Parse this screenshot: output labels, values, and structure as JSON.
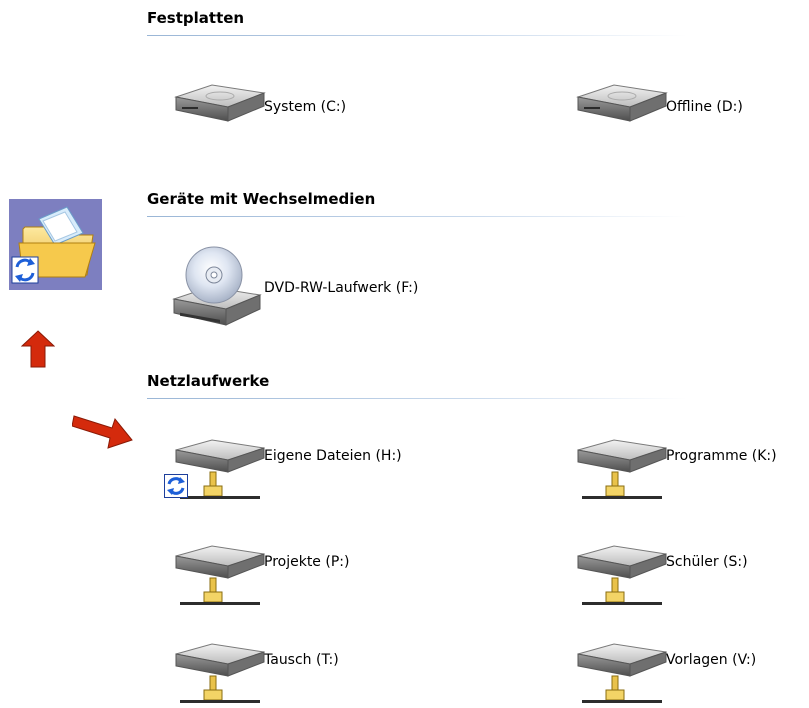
{
  "groups": [
    {
      "title": "Festplatten",
      "drives": [
        {
          "label": "System (C:)",
          "icon": "hard-disk-icon"
        },
        {
          "label": "Offline (D:)",
          "icon": "hard-disk-icon"
        }
      ]
    },
    {
      "title": "Geräte mit Wechselmedien",
      "drives": [
        {
          "label": "DVD-RW-Laufwerk (F:)",
          "icon": "dvd-drive-icon"
        }
      ]
    },
    {
      "title": "Netzlaufwerke",
      "drives": [
        {
          "label": "Eigene Dateien (H:)",
          "icon": "network-drive-icon",
          "badge": "sync-icon"
        },
        {
          "label": "Programme (K:)",
          "icon": "network-drive-icon"
        },
        {
          "label": "Projekte (P:)",
          "icon": "network-drive-icon"
        },
        {
          "label": "Schüler (S:)",
          "icon": "network-drive-icon"
        },
        {
          "label": "Tausch (T:)",
          "icon": "network-drive-icon"
        },
        {
          "label": "Vorlagen (V:)",
          "icon": "network-drive-icon"
        }
      ]
    }
  ],
  "annotations": {
    "side_icon": "offline-files-sync-icon",
    "arrows": [
      "up-arrow-icon",
      "diagonal-arrow-icon"
    ],
    "arrow_color": "#d42a0c"
  }
}
